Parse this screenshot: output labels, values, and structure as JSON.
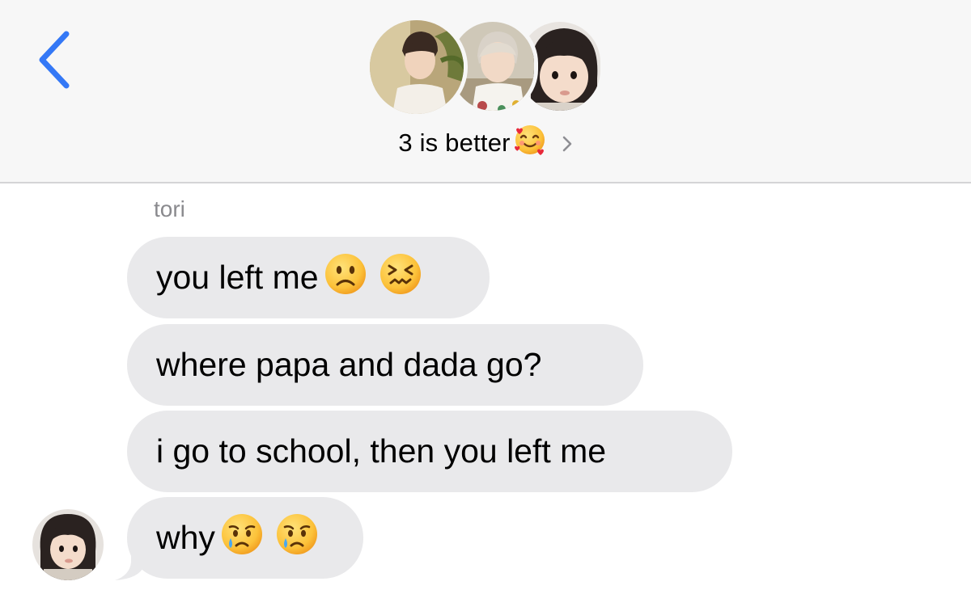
{
  "header": {
    "title": "3 is better",
    "title_emoji": "smiling-face-with-hearts",
    "back_icon": "chevron-left-icon",
    "detail_icon": "chevron-right-icon",
    "accent_color": "#3478f6"
  },
  "conversation": {
    "sender_name": "tori",
    "bubble_color": "#e9e9eb",
    "messages": [
      {
        "text": "you left me",
        "emojis": [
          "slightly-frowning-face",
          "confounded-face"
        ]
      },
      {
        "text": "where papa and dada go?",
        "emojis": []
      },
      {
        "text": "i go to school, then you left me",
        "emojis": []
      },
      {
        "text": "why",
        "emojis": [
          "crying-face",
          "crying-face"
        ]
      }
    ]
  }
}
